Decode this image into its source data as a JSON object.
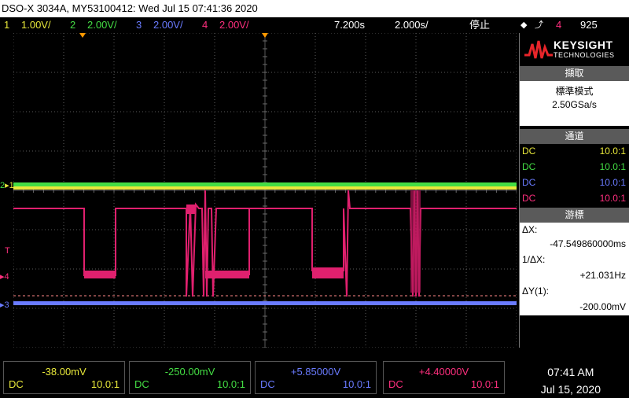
{
  "title": "DSO-X 3034A, MY53100412: Wed Jul 15 07:41:36 2020",
  "channels": [
    {
      "num": "1",
      "scale": "1.00V/",
      "color": "#e8e83a"
    },
    {
      "num": "2",
      "scale": "2.00V/",
      "color": "#44dd44"
    },
    {
      "num": "3",
      "scale": "2.00V/",
      "color": "#6a7bff"
    },
    {
      "num": "4",
      "scale": "2.00V/",
      "color": "#ff2f7e"
    }
  ],
  "timebase": {
    "delay": "7.200s",
    "scale": "2.000s/",
    "run_state": "停止"
  },
  "trigger": {
    "channel": "4",
    "level": "925"
  },
  "logo": {
    "brand": "KEYSIGHT",
    "sub": "TECHNOLOGIES"
  },
  "acquire": {
    "header": "擷取",
    "mode": "標準模式",
    "rate": "2.50GSa/s"
  },
  "channels_panel": {
    "header": "通道",
    "rows": [
      {
        "coupling": "DC",
        "probe": "10.0:1",
        "color": "#e8e83a"
      },
      {
        "coupling": "DC",
        "probe": "10.0:1",
        "color": "#44dd44"
      },
      {
        "coupling": "DC",
        "probe": "10.0:1",
        "color": "#6a7bff"
      },
      {
        "coupling": "DC",
        "probe": "10.0:1",
        "color": "#ff2f7e"
      }
    ]
  },
  "cursors": {
    "header": "游標",
    "dx_label": "ΔX:",
    "dx_value": "-47.549860000ms",
    "inv_dx_label": "1/ΔX:",
    "inv_dx_value": "+21.031Hz",
    "dy_label": "ΔY(1):",
    "dy_value": "-200.00mV"
  },
  "bottom": [
    {
      "value": "-38.00mV",
      "coupling": "DC",
      "probe": "10.0:1",
      "color": "#e8e83a"
    },
    {
      "value": "-250.00mV",
      "coupling": "DC",
      "probe": "10.0:1",
      "color": "#44dd44"
    },
    {
      "value": "+5.85000V",
      "coupling": "DC",
      "probe": "10.0:1",
      "color": "#6a7bff"
    },
    {
      "value": "+4.40000V",
      "coupling": "DC",
      "probe": "10.0:1",
      "color": "#ff2f7e"
    }
  ],
  "clock": {
    "time": "07:41 AM",
    "date": "Jul 15, 2020"
  },
  "markers": {
    "ch1": "1",
    "ch2": "2",
    "ch3": "3",
    "ch4": "4",
    "trig": "T"
  }
}
